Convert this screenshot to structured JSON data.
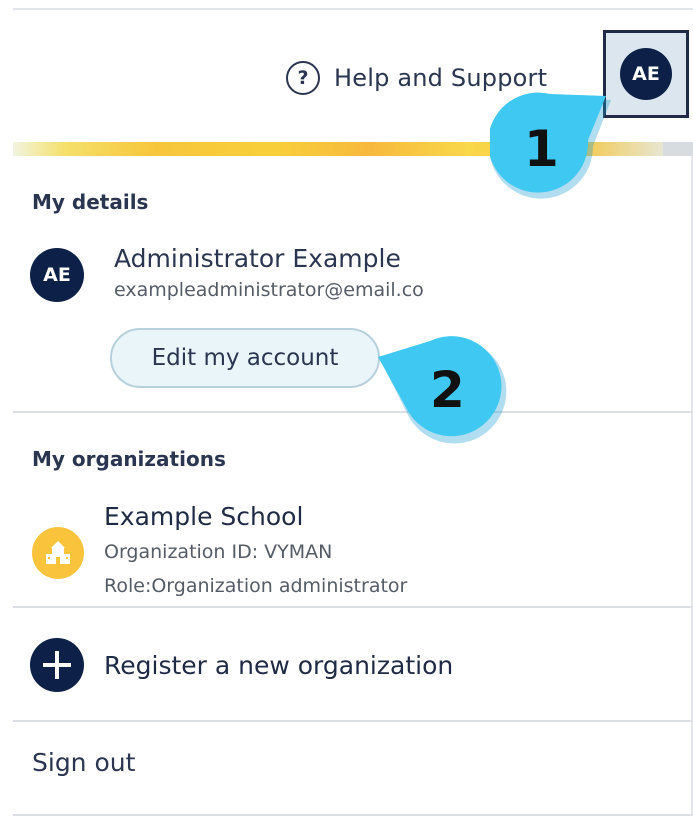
{
  "header": {
    "help_label": "Help and Support",
    "help_icon": "help-circle-icon",
    "avatar_initials": "AE"
  },
  "my_details": {
    "title": "My details",
    "avatar_initials": "AE",
    "name": "Administrator Example",
    "email": "exampleadministrator@email.co",
    "edit_label": "Edit my account"
  },
  "my_organizations": {
    "title": "My organizations",
    "org_icon": "school-icon",
    "org_name": "Example School",
    "org_id_text": "Organization ID: VYMAN",
    "role_text": "Role:Organization administrator"
  },
  "register": {
    "label": "Register a new organization",
    "icon": "plus-circle-icon"
  },
  "sign_out_label": "Sign out",
  "callouts": [
    {
      "number": "1"
    },
    {
      "number": "2"
    }
  ],
  "colors": {
    "navy": "#0d2148",
    "callout": "#3fc8f2",
    "org_icon_bg": "#f9c33b",
    "edit_button_bg": "#eaf5f9"
  }
}
